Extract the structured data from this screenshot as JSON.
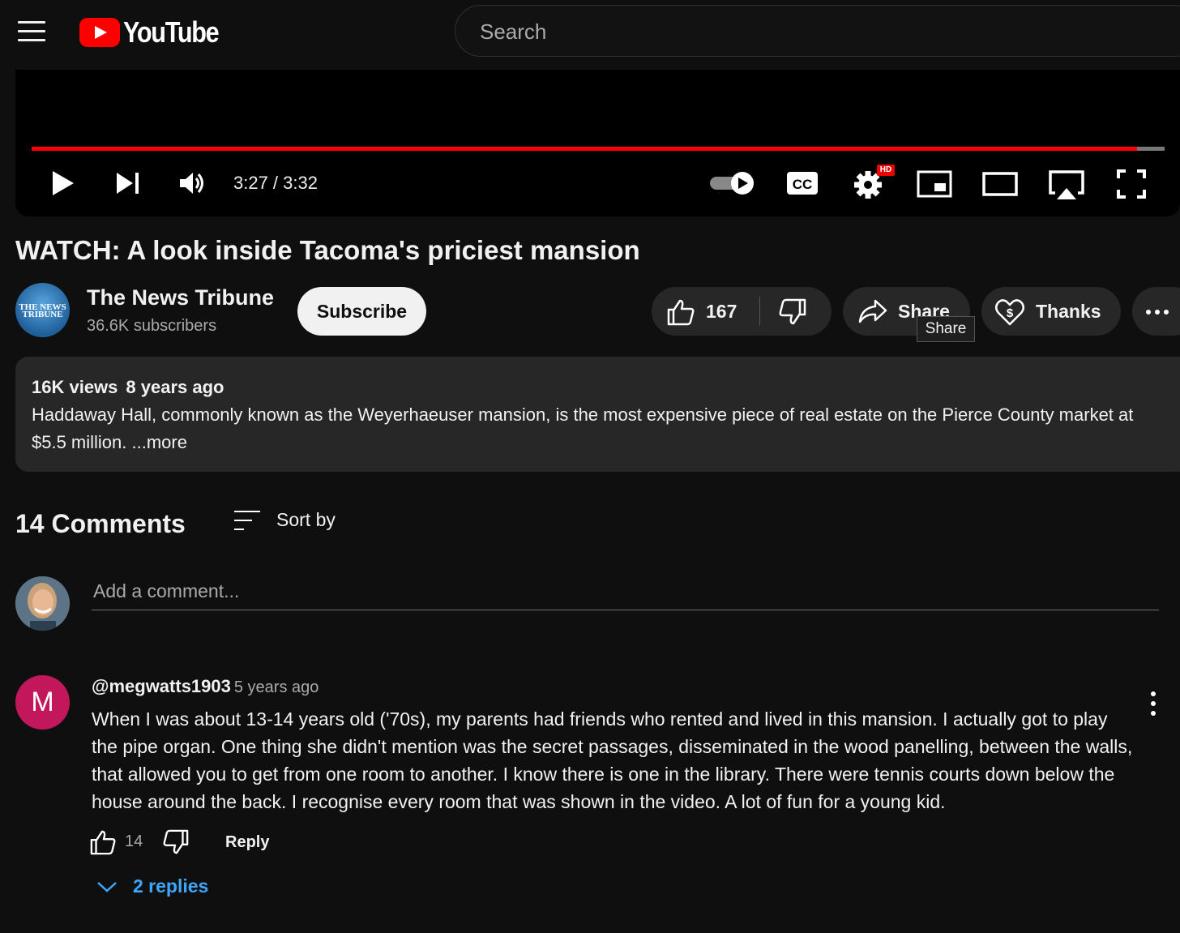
{
  "header": {
    "logo_text": "YouTube",
    "search_placeholder": "Search"
  },
  "player": {
    "time_display": "3:27 / 3:32",
    "progress_fraction": 0.976,
    "hd_badge": "HD",
    "colors": {
      "progress": "#ff0000",
      "track": "#777777"
    }
  },
  "video": {
    "title": "WATCH: A look inside Tacoma's priciest mansion"
  },
  "channel": {
    "name": "The News Tribune",
    "subscribers": "36.6K subscribers",
    "avatar_logo_line1": "THE NEWS",
    "avatar_logo_line2": "TRIBUNE",
    "subscribe_label": "Subscribe"
  },
  "actions": {
    "like_count": "167",
    "share_label": "Share",
    "share_tooltip": "Share",
    "thanks_label": "Thanks"
  },
  "description": {
    "views": "16K views",
    "age": "8 years ago",
    "text": "Haddaway Hall, commonly known as the Weyerhaeuser mansion, is the most expensive piece of real estate on the Pierce County market at $5.5 million. ",
    "more_label": "...more"
  },
  "comments": {
    "count_label": "14 Comments",
    "sort_label": "Sort by",
    "add_placeholder": "Add a comment...",
    "items": [
      {
        "avatar_letter": "M",
        "avatar_color": "#c2185b",
        "author": "@megwatts1903",
        "time": "5 years ago",
        "text": "When I was about 13-14 years old ('70s), my parents had friends who rented and lived in this mansion.  I actually got to play the pipe organ.  One thing she didn't mention was the secret passages, disseminated in the wood panelling, between the walls, that allowed you to get from one room to another.  I know there is one in the library.  There were tennis courts down below the house around the back.  I recognise every room that was shown in the video.  A lot of fun for a young kid.",
        "likes": "14",
        "reply_label": "Reply",
        "replies_label": "2 replies"
      }
    ]
  }
}
